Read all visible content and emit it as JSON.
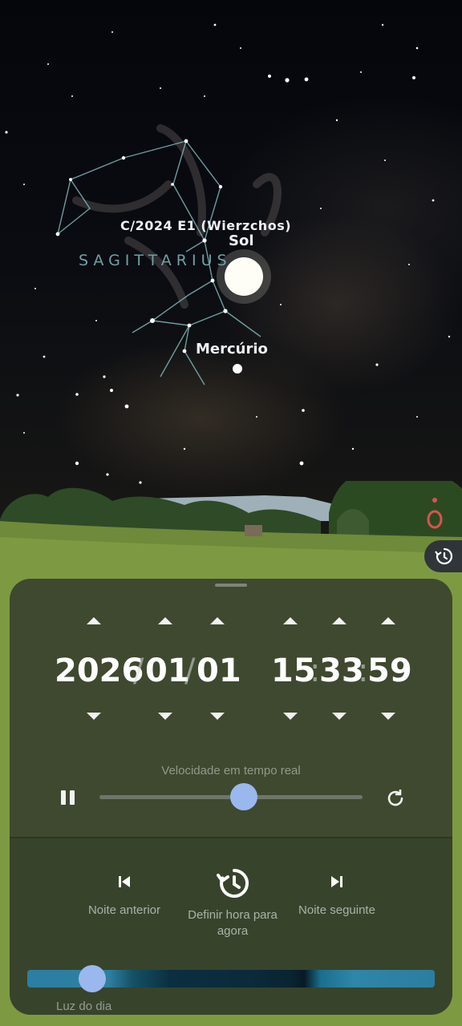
{
  "sky": {
    "objects": [
      {
        "id": "comet",
        "label": "C/2024 E1 (Wierzchos)"
      },
      {
        "id": "sun",
        "label": "Sol"
      },
      {
        "id": "mercury",
        "label": "Mercúrio"
      }
    ],
    "constellation": "SAGITTARIUS"
  },
  "side_controls": {
    "compass_icon": "compass-needle-icon",
    "history_icon": "history-icon"
  },
  "time_panel": {
    "year": "2026",
    "month": "01",
    "day": "01",
    "hour": "15",
    "minute": "33",
    "second": "59",
    "date_separator": "/",
    "time_separator": ":",
    "speed_label": "Velocidade em tempo real",
    "speed_position": 0.55,
    "prev_night_label": "Noite anterior",
    "set_now_label": "Definir hora para agora",
    "next_night_label": "Noite seguinte",
    "daylight_label": "Luz do dia",
    "daylight_position": 0.16
  },
  "colors": {
    "accent": "#9ab8ee",
    "constellation_label": "#6fa0a4",
    "compass_needle": "#d9534f"
  }
}
